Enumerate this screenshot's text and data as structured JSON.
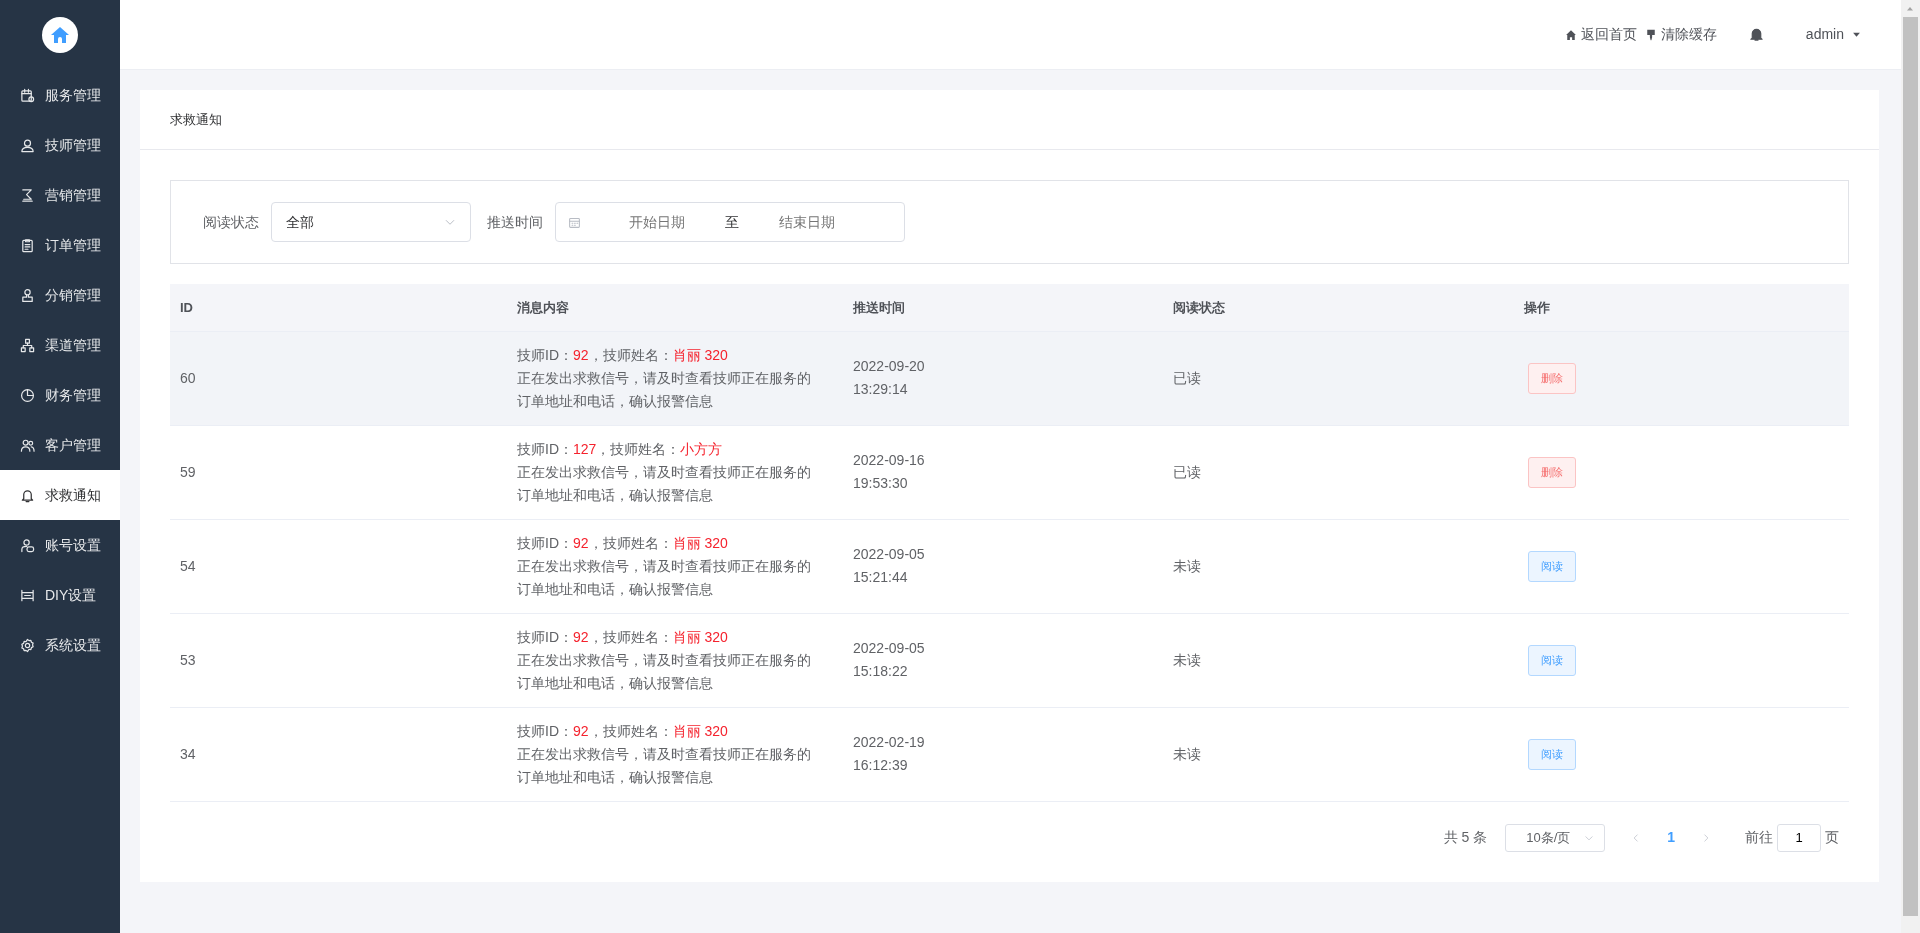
{
  "sidebar": {
    "items": [
      {
        "label": "服务管理",
        "selected": false
      },
      {
        "label": "技师管理",
        "selected": false
      },
      {
        "label": "营销管理",
        "selected": false
      },
      {
        "label": "订单管理",
        "selected": false
      },
      {
        "label": "分销管理",
        "selected": false
      },
      {
        "label": "渠道管理",
        "selected": false
      },
      {
        "label": "财务管理",
        "selected": false
      },
      {
        "label": "客户管理",
        "selected": false
      },
      {
        "label": "求救通知",
        "selected": true
      },
      {
        "label": "账号设置",
        "selected": false
      },
      {
        "label": "DIY设置",
        "selected": false
      },
      {
        "label": "系统设置",
        "selected": false
      }
    ]
  },
  "header": {
    "home_link": "返回首页",
    "clear_cache": "清除缓存",
    "user": "admin"
  },
  "page_title": "求救通知",
  "filters": {
    "read_status_label": "阅读状态",
    "read_status_value": "全部",
    "push_time_label": "推送时间",
    "start_placeholder": "开始日期",
    "range_separator": "至",
    "end_placeholder": "结束日期"
  },
  "table": {
    "columns": [
      "ID",
      "消息内容",
      "推送时间",
      "阅读状态",
      "操作"
    ],
    "rows": [
      {
        "id": "60",
        "id_label": "技师ID：",
        "tech_id": "92",
        "name_label": "，技师姓名：",
        "tech_name": "肖丽 320",
        "message": "正在发出求救信号，请及时查看技师正在服务的订单地址和电话，确认报警信息",
        "date": "2022-09-20",
        "time": "13:29:14",
        "status": "已读",
        "action": {
          "kind": "delete",
          "label": "删除"
        },
        "highlighted": true
      },
      {
        "id": "59",
        "id_label": "技师ID：",
        "tech_id": "127",
        "name_label": "，技师姓名：",
        "tech_name": "小方方",
        "message": "正在发出求救信号，请及时查看技师正在服务的订单地址和电话，确认报警信息",
        "date": "2022-09-16",
        "time": "19:53:30",
        "status": "已读",
        "action": {
          "kind": "delete",
          "label": "删除"
        },
        "highlighted": false
      },
      {
        "id": "54",
        "id_label": "技师ID：",
        "tech_id": "92",
        "name_label": "，技师姓名：",
        "tech_name": "肖丽 320",
        "message": "正在发出求救信号，请及时查看技师正在服务的订单地址和电话，确认报警信息",
        "date": "2022-09-05",
        "time": "15:21:44",
        "status": "未读",
        "action": {
          "kind": "read",
          "label": "阅读"
        },
        "highlighted": false
      },
      {
        "id": "53",
        "id_label": "技师ID：",
        "tech_id": "92",
        "name_label": "，技师姓名：",
        "tech_name": "肖丽 320",
        "message": "正在发出求救信号，请及时查看技师正在服务的订单地址和电话，确认报警信息",
        "date": "2022-09-05",
        "time": "15:18:22",
        "status": "未读",
        "action": {
          "kind": "read",
          "label": "阅读"
        },
        "highlighted": false
      },
      {
        "id": "34",
        "id_label": "技师ID：",
        "tech_id": "92",
        "name_label": "，技师姓名：",
        "tech_name": "肖丽 320",
        "message": "正在发出求救信号，请及时查看技师正在服务的订单地址和电话，确认报警信息",
        "date": "2022-02-19",
        "time": "16:12:39",
        "status": "未读",
        "action": {
          "kind": "read",
          "label": "阅读"
        },
        "highlighted": false
      }
    ]
  },
  "pagination": {
    "total": "共 5 条",
    "page_size": "10条/页",
    "pages": [
      {
        "label": "1",
        "selected": true
      }
    ],
    "goto_label": "前往",
    "goto_value": "1",
    "page_suffix": "页"
  }
}
